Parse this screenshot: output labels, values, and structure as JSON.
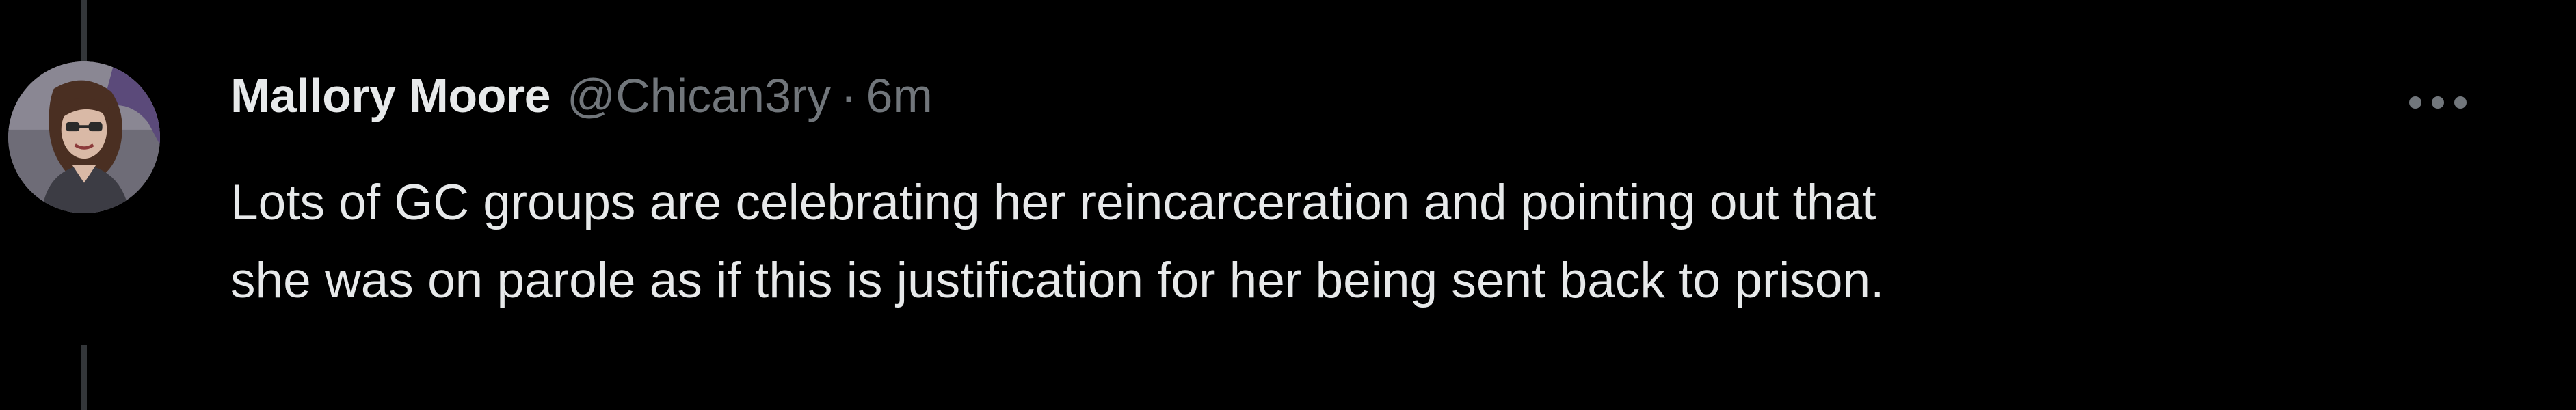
{
  "tweet": {
    "author": {
      "display_name": "Mallory Moore",
      "handle": "@Chican3ry",
      "avatar_icon": "profile-photo"
    },
    "separator": "·",
    "timestamp": "6m",
    "more_icon": "more-horizontal-icon",
    "text_lines": [
      "Lots of GC groups are celebrating her reincarceration and pointing out that",
      "she was on parole as if this is justification for her being sent back to prison."
    ]
  },
  "colors": {
    "background": "#000000",
    "primary_text": "#e7e9ea",
    "secondary_text": "#71767b",
    "thread_line": "#333639"
  }
}
